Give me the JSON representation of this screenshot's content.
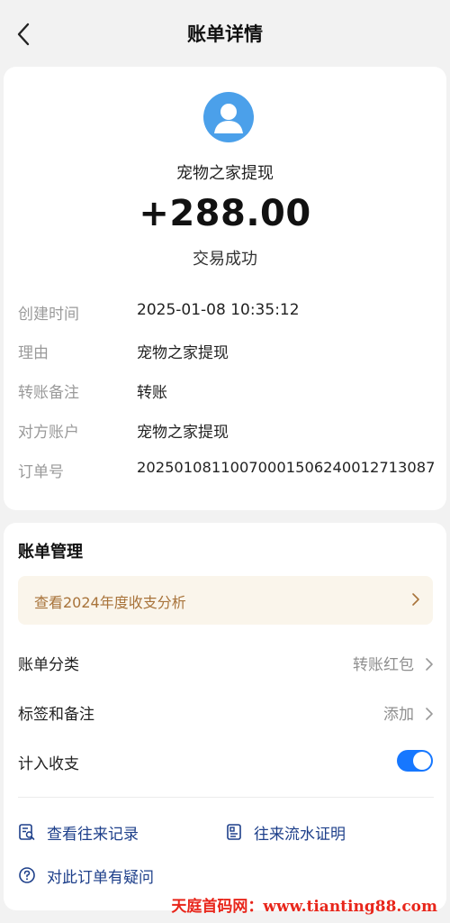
{
  "nav": {
    "title": "账单详情",
    "back_icon": "chevron-left-icon"
  },
  "summary": {
    "avatar_icon": "user-avatar-icon",
    "merchant": "宠物之家提现",
    "amount": "+288.00",
    "status": "交易成功"
  },
  "details": [
    {
      "label": "创建时间",
      "value": "2025-01-08 10:35:12"
    },
    {
      "label": "理由",
      "value": "宠物之家提现"
    },
    {
      "label": "转账备注",
      "value": "转账"
    },
    {
      "label": "对方账户",
      "value": "宠物之家提现"
    },
    {
      "label": "订单号",
      "value": "2025010811007000150624001271308​7"
    }
  ],
  "management": {
    "title": "账单管理",
    "analysis_banner": "查看2024年度收支分析",
    "category": {
      "label": "账单分类",
      "value": "转账红包"
    },
    "tags": {
      "label": "标签和备注",
      "value": "添加"
    },
    "include": {
      "label": "计入收支",
      "enabled": true
    }
  },
  "links": {
    "records": "查看往来记录",
    "proof": "往来流水证明",
    "question": "对此订单有疑问"
  },
  "watermark": "天庭首码网：www.tianting88.com",
  "colors": {
    "accent": "#1677ff",
    "link": "#1d3f8a",
    "banner_text": "#a8733a",
    "avatar": "#4ba0ea",
    "watermark": "#e8261b"
  }
}
